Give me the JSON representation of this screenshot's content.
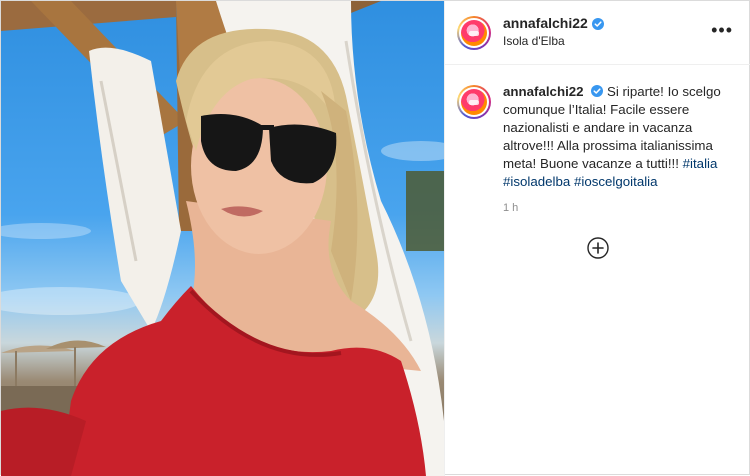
{
  "post": {
    "username": "annafalchi22",
    "location": "Isola d'Elba",
    "more_label": "•••",
    "caption_text": "Si riparte! Io scelgo comunque l’Italia! Facile essere nazionalisti e andare in vacanza altrove!!! Alla prossima italianissima meta! Buone vacanze a tutti!!!",
    "hashtags": [
      "#italia",
      "#isoladelba",
      "#ioscelgoitalia"
    ],
    "time_ago": "1 h"
  },
  "icons": {
    "verified": "verified-badge-icon",
    "more": "more-options-icon",
    "load_more": "plus-circle-icon"
  },
  "colors": {
    "verified": "#3897f0",
    "hashtag": "#00376b",
    "dress": "#c9212b"
  }
}
